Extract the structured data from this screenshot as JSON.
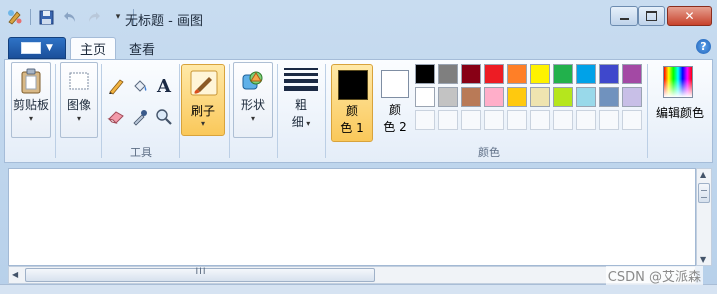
{
  "window": {
    "title": "无标题 - 画图"
  },
  "tabs": {
    "home": "主页",
    "view": "查看"
  },
  "ribbon": {
    "clipboard": {
      "label": "剪贴板"
    },
    "image": {
      "label": "图像"
    },
    "tools": {
      "group_label": "工具",
      "text_glyph": "A"
    },
    "brushes": {
      "label": "刷子"
    },
    "shapes": {
      "label": "形状"
    },
    "size": {
      "label_line1": "粗",
      "label_line2": "细"
    },
    "color1": {
      "label_line1": "颜",
      "label_line2": "色 1"
    },
    "color2": {
      "label_line1": "颜",
      "label_line2": "色 2"
    },
    "colors": {
      "group_label": "颜色",
      "row1": [
        "#000000",
        "#7f7f7f",
        "#880015",
        "#ed1c24",
        "#ff7f27",
        "#fff200",
        "#22b14c",
        "#00a2e8",
        "#3f48cc",
        "#a349a4"
      ],
      "row2": [
        "#ffffff",
        "#c3c3c3",
        "#b97a57",
        "#ffaec9",
        "#ffc90e",
        "#efe4b0",
        "#b5e61d",
        "#99d9ea",
        "#7092be",
        "#c8bfe7"
      ]
    },
    "edit_colors": {
      "label": "编辑颜色"
    }
  },
  "scroll": {
    "grip": "III"
  },
  "watermark": {
    "text": "CSDN @艾派森"
  }
}
